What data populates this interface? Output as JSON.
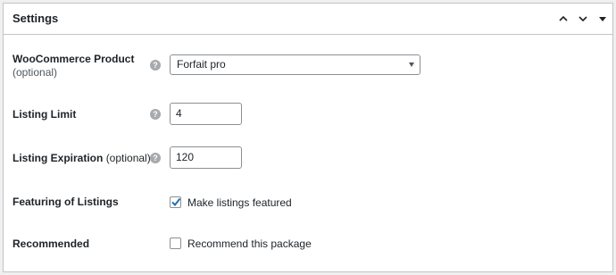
{
  "panel": {
    "title": "Settings",
    "controls": {
      "collapse_up_icon": "chevron-up-icon",
      "collapse_down_icon": "chevron-down-icon",
      "toggle_icon": "triangle-down-icon"
    }
  },
  "fields": {
    "product": {
      "label": "WooCommerce Product",
      "sublabel": "(optional)",
      "help_icon": "help-icon",
      "selected": "Forfait pro"
    },
    "limit": {
      "label": "Listing Limit",
      "help_icon": "help-icon",
      "value": "4"
    },
    "expiration": {
      "label": "Listing Expiration",
      "label_suffix": "(optional)",
      "help_icon": "help-icon",
      "value": "120"
    },
    "featuring": {
      "label": "Featuring of Listings",
      "checkbox_label": "Make listings featured",
      "checked": true
    },
    "recommended": {
      "label": "Recommended",
      "checkbox_label": "Recommend this package",
      "checked": false
    }
  },
  "colors": {
    "accent": "#2271b1",
    "border": "#c3c4c7",
    "help": "#a7aaad"
  }
}
